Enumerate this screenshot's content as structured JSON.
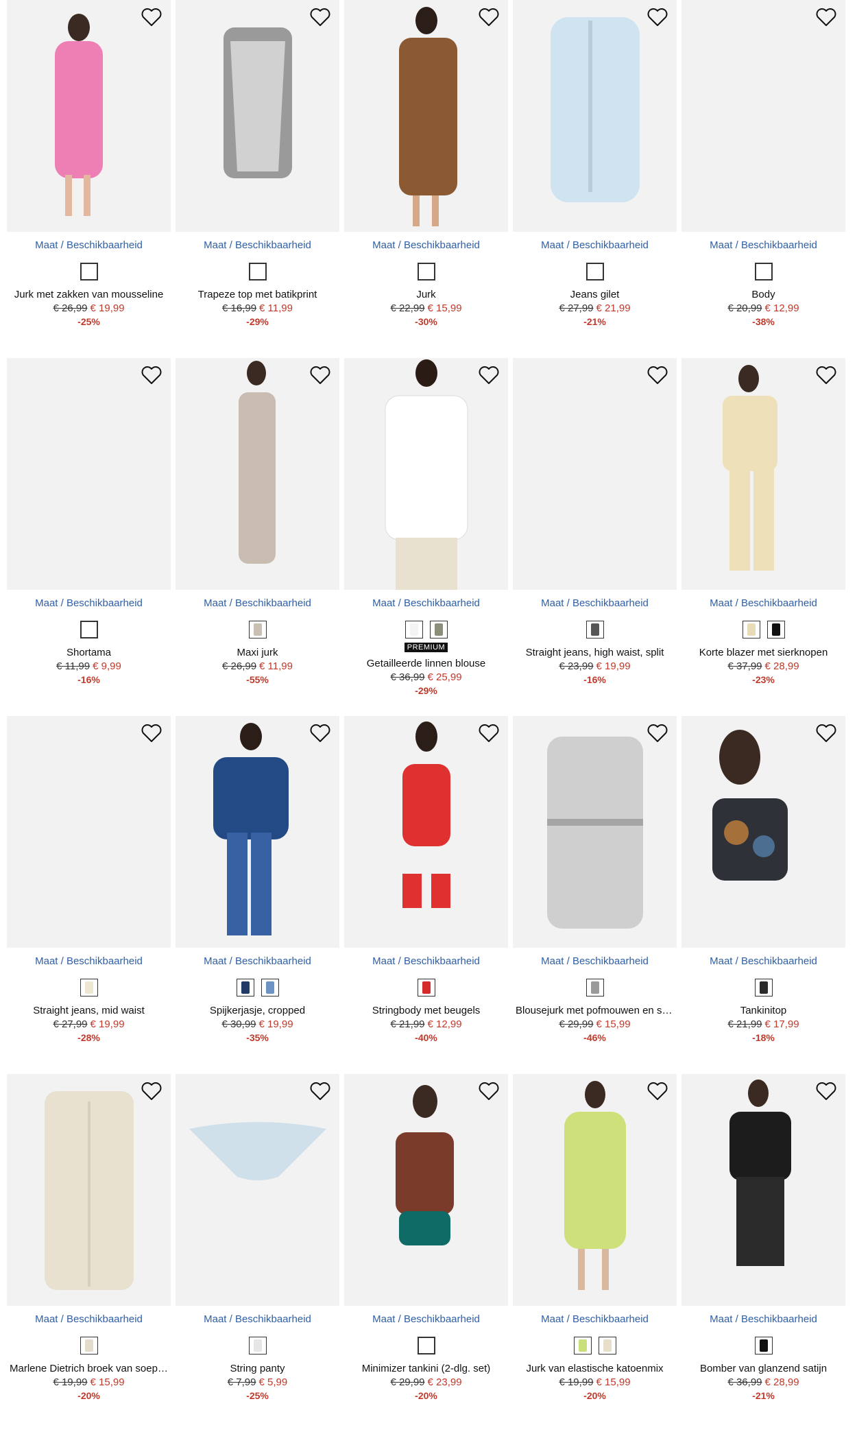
{
  "colors": {
    "accent_link": "#2f5fa7",
    "price_red": "#c0392b",
    "photo_bg": "#f2f2f2"
  },
  "products": [
    {
      "title": "Jurk met zakken van mousseline",
      "maat": "Maat / Beschikbaarheid",
      "old": "€ 26,99",
      "new": "€ 19,99",
      "disc": "-25%",
      "swatches": [
        "plain"
      ],
      "premium": "",
      "heart_icon": "heart-outline-icon"
    },
    {
      "title": "Trapeze top met batikprint",
      "maat": "Maat / Beschikbaarheid",
      "old": "€ 16,99",
      "new": "€ 11,99",
      "disc": "-29%",
      "swatches": [
        "plain"
      ],
      "premium": ""
    },
    {
      "title": "Jurk",
      "maat": "Maat / Beschikbaarheid",
      "old": "€ 22,99",
      "new": "€ 15,99",
      "disc": "-30%",
      "swatches": [
        "plain"
      ],
      "premium": ""
    },
    {
      "title": "Jeans gilet",
      "maat": "Maat / Beschikbaarheid",
      "old": "€ 27,99",
      "new": "€ 21,99",
      "disc": "-21%",
      "swatches": [
        "plain"
      ],
      "premium": ""
    },
    {
      "title": "Body",
      "maat": "Maat / Beschikbaarheid",
      "old": "€ 20,99",
      "new": "€ 12,99",
      "disc": "-38%",
      "swatches": [
        "plain"
      ],
      "premium": ""
    },
    {
      "title": "Shortama",
      "maat": "Maat / Beschikbaarheid",
      "old": "€ 11,99",
      "new": "€ 9,99",
      "disc": "-16%",
      "swatches": [
        "plain"
      ],
      "premium": ""
    },
    {
      "title": "Maxi jurk",
      "maat": "Maat / Beschikbaarheid",
      "old": "€ 26,99",
      "new": "€ 11,99",
      "disc": "-55%",
      "swatches": [
        "#c9bfb2"
      ],
      "premium": ""
    },
    {
      "title": "Getailleerde linnen blouse",
      "maat": "Maat / Beschikbaarheid",
      "old": "€ 36,99",
      "new": "€ 25,99",
      "disc": "-29%",
      "swatches": [
        "#f4f4f4",
        "#8a8f7a"
      ],
      "premium": "PREMIUM"
    },
    {
      "title": "Straight jeans, high waist, split",
      "maat": "Maat / Beschikbaarheid",
      "old": "€ 23,99",
      "new": "€ 19,99",
      "disc": "-16%",
      "swatches": [
        "#555555"
      ],
      "premium": ""
    },
    {
      "title": "Korte blazer met sierknopen",
      "maat": "Maat / Beschikbaarheid",
      "old": "€ 37,99",
      "new": "€ 28,99",
      "disc": "-23%",
      "swatches": [
        "#e8dcb8",
        "#111111"
      ],
      "premium": ""
    },
    {
      "title": "Straight jeans, mid waist",
      "maat": "Maat / Beschikbaarheid",
      "old": "€ 27,99",
      "new": "€ 19,99",
      "disc": "-28%",
      "swatches": [
        "#efe6d2"
      ],
      "premium": ""
    },
    {
      "title": "Spijkerjasje, cropped",
      "maat": "Maat / Beschikbaarheid",
      "old": "€ 30,99",
      "new": "€ 19,99",
      "disc": "-35%",
      "swatches": [
        "#1f3b66",
        "#6d93c4"
      ],
      "premium": ""
    },
    {
      "title": "Stringbody met beugels",
      "maat": "Maat / Beschikbaarheid",
      "old": "€ 21,99",
      "new": "€ 12,99",
      "disc": "-40%",
      "swatches": [
        "#d62a2a"
      ],
      "premium": ""
    },
    {
      "title": "Blousejurk met pofmouwen en stri…",
      "maat": "Maat / Beschikbaarheid",
      "old": "€ 29,99",
      "new": "€ 15,99",
      "disc": "-46%",
      "swatches": [
        "#9a9a9a"
      ],
      "premium": ""
    },
    {
      "title": "Tankinitop",
      "maat": "Maat / Beschikbaarheid",
      "old": "€ 21,99",
      "new": "€ 17,99",
      "disc": "-18%",
      "swatches": [
        "#2b2b2b"
      ],
      "premium": ""
    },
    {
      "title": "Marlene Dietrich broek van soepelv…",
      "maat": "Maat / Beschikbaarheid",
      "old": "€ 19,99",
      "new": "€ 15,99",
      "disc": "-20%",
      "swatches": [
        "#e3dccb"
      ],
      "premium": ""
    },
    {
      "title": "String panty",
      "maat": "Maat / Beschikbaarheid",
      "old": "€ 7,99",
      "new": "€ 5,99",
      "disc": "-25%",
      "swatches": [
        "#e6e6e6"
      ],
      "premium": ""
    },
    {
      "title": "Minimizer tankini (2-dlg. set)",
      "maat": "Maat / Beschikbaarheid",
      "old": "€ 29,99",
      "new": "€ 23,99",
      "disc": "-20%",
      "swatches": [
        "plain"
      ],
      "premium": ""
    },
    {
      "title": "Jurk van elastische katoenmix",
      "maat": "Maat / Beschikbaarheid",
      "old": "€ 19,99",
      "new": "€ 15,99",
      "disc": "-20%",
      "swatches": [
        "#c9e07a",
        "#e7dfc9"
      ],
      "premium": ""
    },
    {
      "title": "Bomber van glanzend satijn",
      "maat": "Maat / Beschikbaarheid",
      "old": "€ 36,99",
      "new": "€ 28,99",
      "disc": "-21%",
      "swatches": [
        "#111111"
      ],
      "premium": ""
    }
  ]
}
